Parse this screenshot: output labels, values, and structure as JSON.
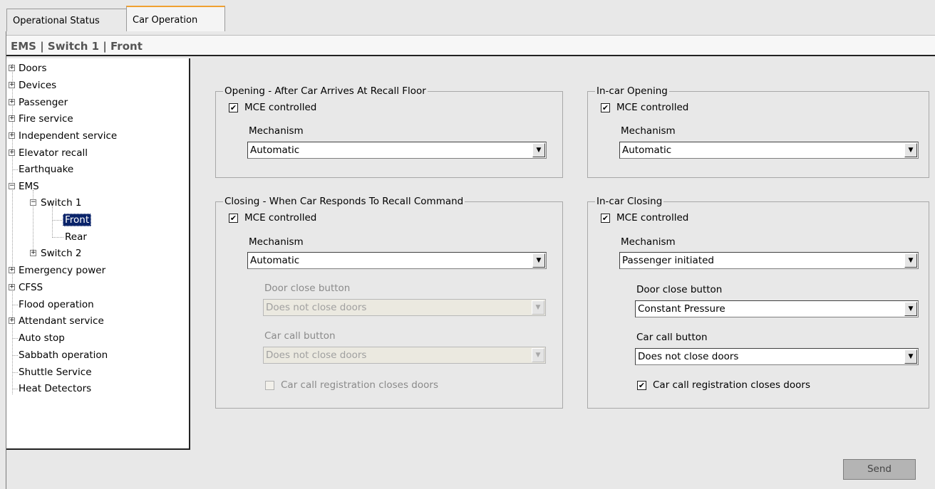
{
  "tabs": [
    "Operational Status",
    "Car Operation"
  ],
  "active_tab": "Car Operation",
  "breadcrumb": "EMS | Switch 1 | Front",
  "tree": {
    "doors": "Doors",
    "devices": "Devices",
    "passenger": "Passenger",
    "fire_service": "Fire service",
    "independent_service": "Independent service",
    "elevator_recall": "Elevator recall",
    "earthquake": "Earthquake",
    "ems": "EMS",
    "switch1": "Switch 1",
    "front": "Front",
    "rear": "Rear",
    "switch2": "Switch 2",
    "emergency_power": "Emergency power",
    "cfss": "CFSS",
    "flood_operation": "Flood operation",
    "attendant_service": "Attendant service",
    "auto_stop": "Auto stop",
    "sabbath_operation": "Sabbath operation",
    "shuttle_service": "Shuttle Service",
    "heat_detectors": "Heat Detectors"
  },
  "opening_recall": {
    "legend": "Opening - After Car Arrives At Recall Floor",
    "mce_label": "MCE controlled",
    "mce_checked": true,
    "mechanism_label": "Mechanism",
    "mechanism_value": "Automatic"
  },
  "incar_opening": {
    "legend": "In-car Opening",
    "mce_label": "MCE controlled",
    "mce_checked": true,
    "mechanism_label": "Mechanism",
    "mechanism_value": "Automatic"
  },
  "closing_recall": {
    "legend": "Closing - When Car Responds To Recall Command",
    "mce_label": "MCE controlled",
    "mce_checked": true,
    "mechanism_label": "Mechanism",
    "mechanism_value": "Automatic",
    "door_close_label": "Door close button",
    "door_close_value": "Does not close doors",
    "car_call_label": "Car call button",
    "car_call_value": "Does not close doors",
    "registration_label": "Car call registration closes doors",
    "registration_checked": false
  },
  "incar_closing": {
    "legend": "In-car Closing",
    "mce_label": "MCE controlled",
    "mce_checked": true,
    "mechanism_label": "Mechanism",
    "mechanism_value": "Passenger initiated",
    "door_close_label": "Door close button",
    "door_close_value": "Constant Pressure",
    "car_call_label": "Car call button",
    "car_call_value": "Does not close doors",
    "registration_label": "Car call registration closes doors",
    "registration_checked": true
  },
  "send_label": "Send",
  "icons": {
    "expand": "plus-box-icon",
    "collapse": "minus-box-icon",
    "dropdown": "chevron-down-icon",
    "check": "checkmark-icon"
  }
}
